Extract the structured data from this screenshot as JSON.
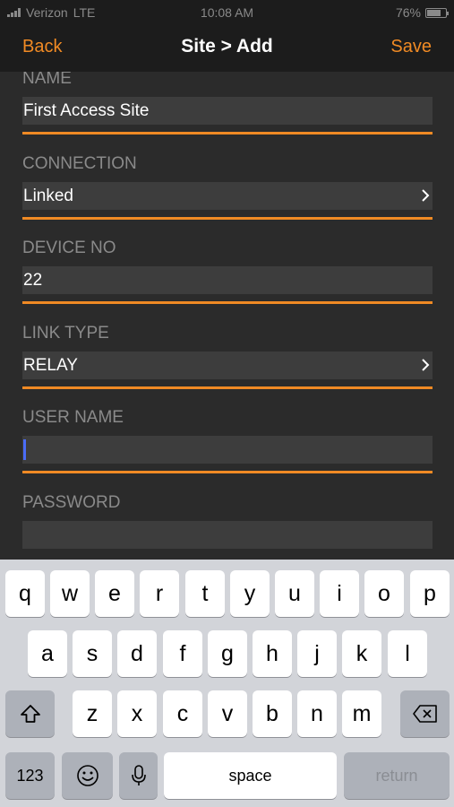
{
  "status_bar": {
    "carrier": "Verizon",
    "network": "LTE",
    "time": "10:08 AM",
    "battery": "76%",
    "battery_level": 0.76
  },
  "nav": {
    "back_label": "Back",
    "title": "Site > Add",
    "save_label": "Save"
  },
  "form": {
    "fields": [
      {
        "label": "NAME",
        "value": "First Access Site"
      },
      {
        "label": "CONNECTION",
        "value": "Linked"
      },
      {
        "label": "DEVICE NO",
        "value": "22"
      },
      {
        "label": "LINK TYPE",
        "value": "RELAY"
      },
      {
        "label": "USER NAME",
        "value": ""
      },
      {
        "label": "PASSWORD",
        "value": ""
      }
    ]
  },
  "keyboard": {
    "row1": [
      "q",
      "w",
      "e",
      "r",
      "t",
      "y",
      "u",
      "i",
      "o",
      "p"
    ],
    "row2": [
      "a",
      "s",
      "d",
      "f",
      "g",
      "h",
      "j",
      "k",
      "l"
    ],
    "row3": [
      "z",
      "x",
      "c",
      "v",
      "b",
      "n",
      "m"
    ],
    "numbers_label": "123",
    "space_label": "space",
    "return_label": "return"
  },
  "colors": {
    "accent": "#f08a24",
    "background": "#2b2b2b",
    "field": "#3d3d3d",
    "cursor": "#4a6cf7"
  }
}
